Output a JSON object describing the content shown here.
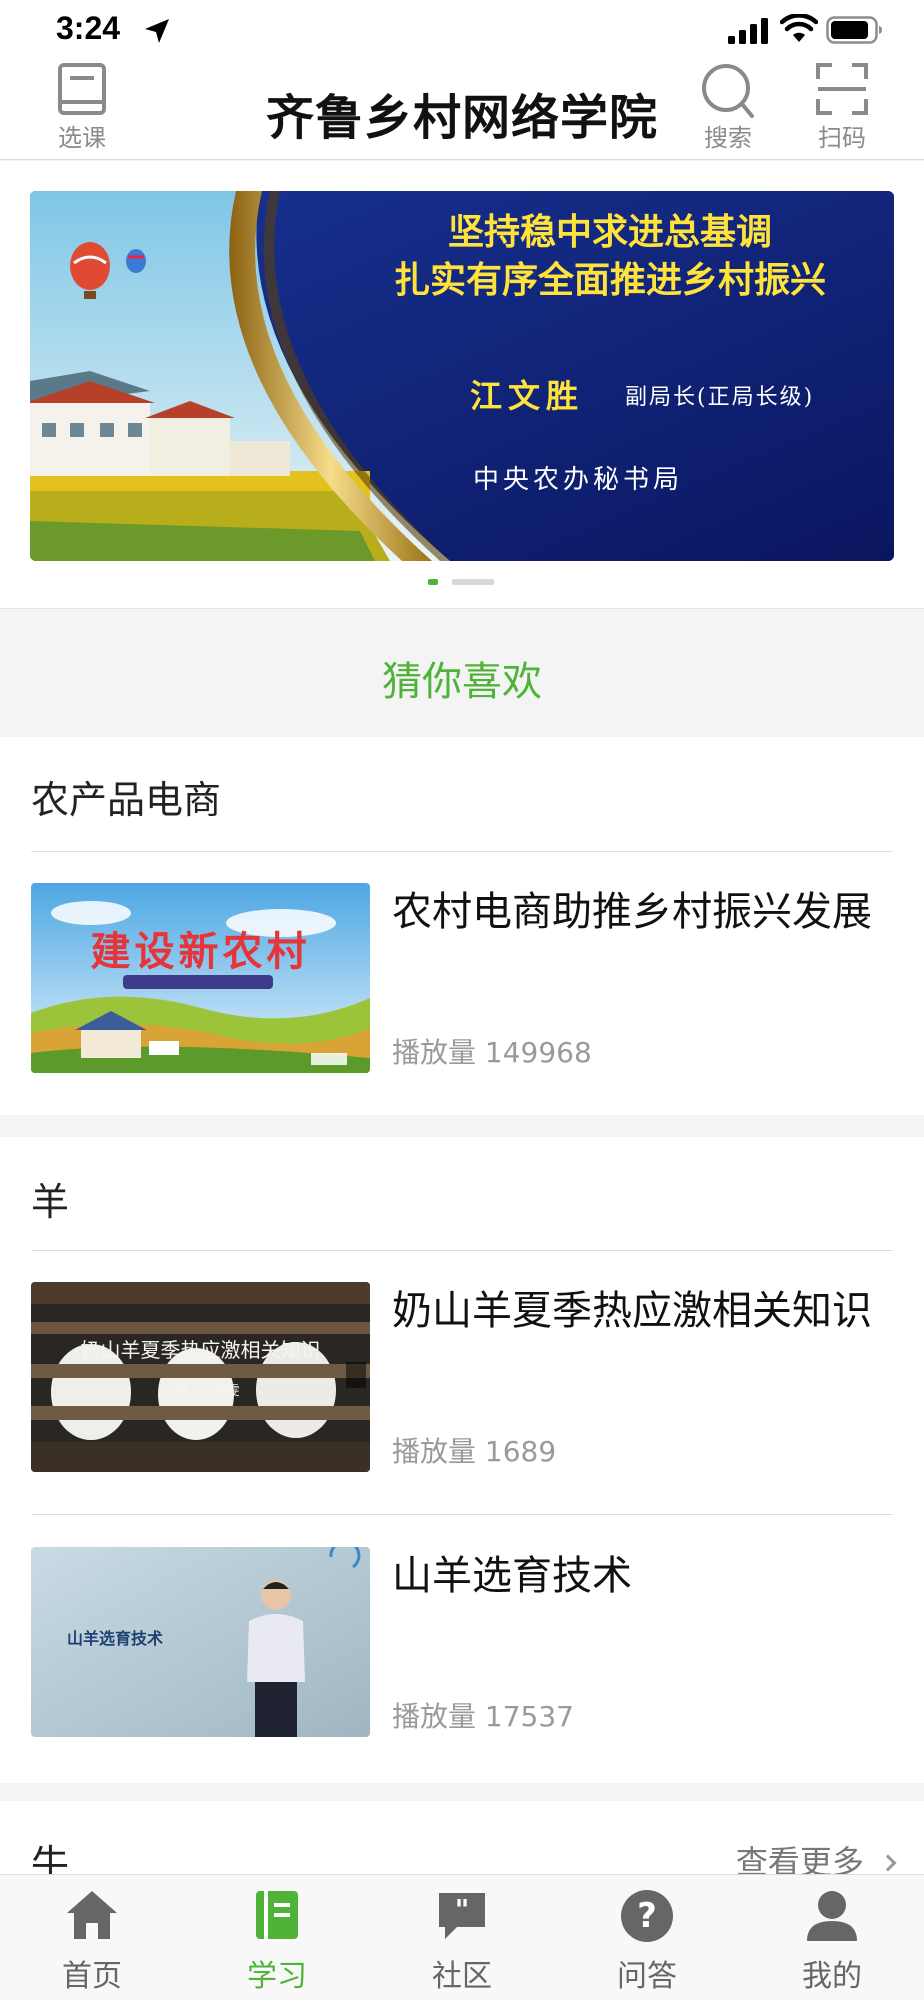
{
  "status_bar": {
    "time": "3:24"
  },
  "header": {
    "title": "齐鲁乡村网络学院",
    "course_label": "选课",
    "search_label": "搜索",
    "scan_label": "扫码"
  },
  "banner": {
    "line1": "坚持稳中求进总基调",
    "line2": "扎实有序全面推进乡村振兴",
    "speaker": "江文胜",
    "role": "副局长(正局长级)",
    "org": "中央农办秘书局"
  },
  "guess": {
    "label": "猜你喜欢"
  },
  "sections": [
    {
      "title": "农产品电商",
      "courses": [
        {
          "title": "农村电商助推乡村振兴发展",
          "plays": "播放量 149968",
          "thumb_text": "建设新农村"
        }
      ]
    },
    {
      "title": "羊",
      "courses": [
        {
          "title": "奶山羊夏季热应激相关知识",
          "plays": "播放量 1689",
          "thumb_text": "奶山羊夏季热应激相关知识",
          "thumb_sub": "主讲人：宋雯"
        },
        {
          "title": "山羊选育技术",
          "plays": "播放量 17537",
          "thumb_text": "山羊选育技术"
        }
      ]
    },
    {
      "title": "牛",
      "more": "查看更多"
    }
  ],
  "tabbar": {
    "tabs": [
      {
        "label": "首页",
        "icon": "home-icon"
      },
      {
        "label": "学习",
        "icon": "book-icon",
        "active": true
      },
      {
        "label": "社区",
        "icon": "chat-quote-icon"
      },
      {
        "label": "问答",
        "icon": "question-icon"
      },
      {
        "label": "我的",
        "icon": "user-icon"
      }
    ]
  },
  "colors": {
    "accent": "#4fb339",
    "banner_bg": "#0e1c6e",
    "banner_title": "#ffe23a"
  }
}
